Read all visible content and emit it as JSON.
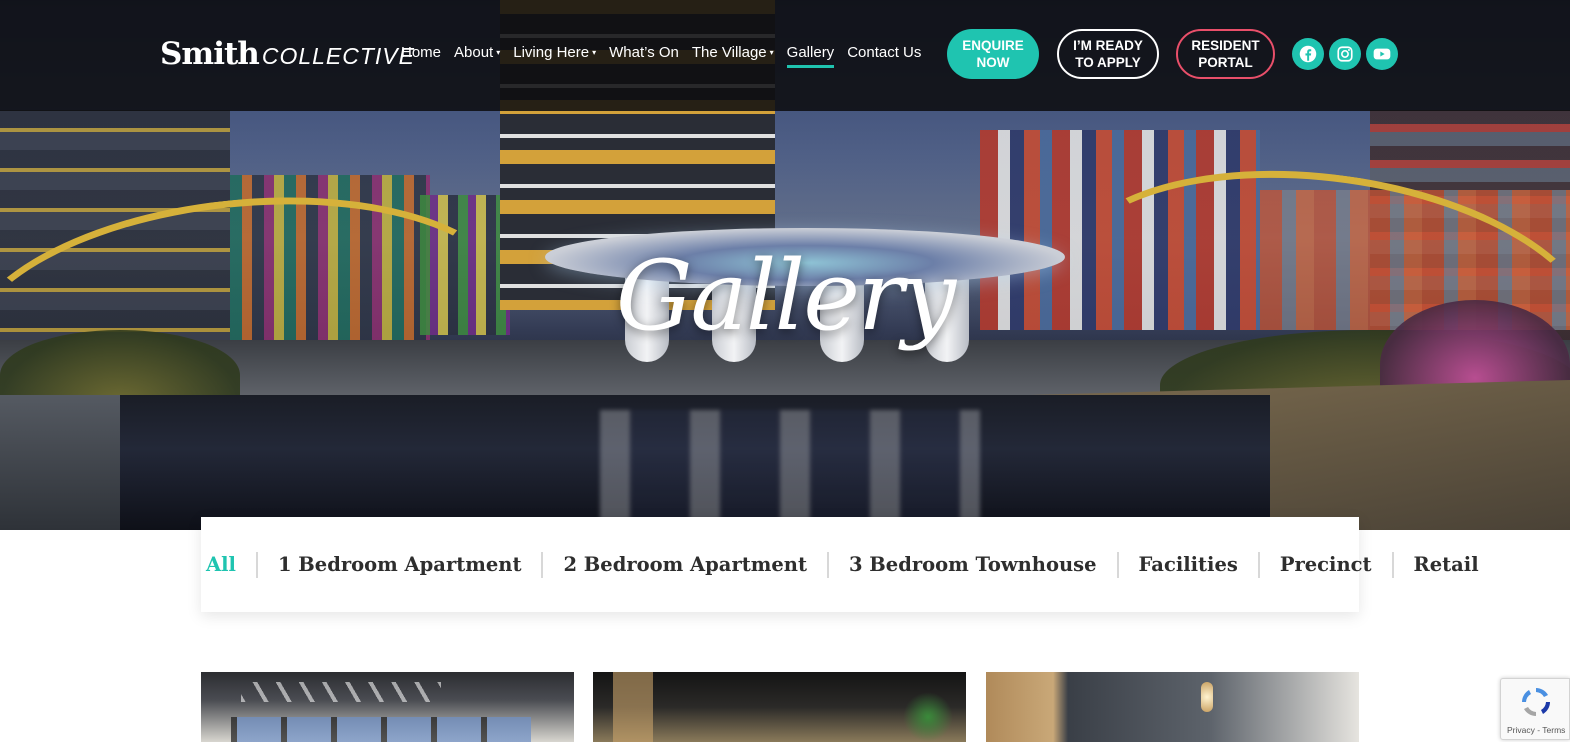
{
  "brand": {
    "logo_main": "Smith",
    "logo_sub": "COLLECTIVE"
  },
  "nav": {
    "items": [
      {
        "label": "Home",
        "dropdown": false,
        "active": false
      },
      {
        "label": "About",
        "dropdown": true,
        "active": false
      },
      {
        "label": "Living Here",
        "dropdown": true,
        "active": false
      },
      {
        "label": "What’s On",
        "dropdown": false,
        "active": false
      },
      {
        "label": "The Village",
        "dropdown": true,
        "active": false
      },
      {
        "label": "Gallery",
        "dropdown": false,
        "active": true
      },
      {
        "label": "Contact Us",
        "dropdown": false,
        "active": false
      }
    ],
    "dropdown_caret": "▾"
  },
  "cta": {
    "enquire_line1": "ENQUIRE",
    "enquire_line2": "NOW",
    "apply_line1": "I’M READY",
    "apply_line2": "TO APPLY",
    "portal_line1": "RESIDENT",
    "portal_line2": "PORTAL"
  },
  "social": [
    {
      "icon": "facebook-icon"
    },
    {
      "icon": "instagram-icon"
    },
    {
      "icon": "youtube-icon"
    }
  ],
  "hero": {
    "title": "Gallery"
  },
  "filters": {
    "items": [
      {
        "label": "All",
        "active": true
      },
      {
        "label": "1 Bedroom Apartment",
        "active": false
      },
      {
        "label": "2 Bedroom Apartment",
        "active": false
      },
      {
        "label": "3 Bedroom Townhouse",
        "active": false
      },
      {
        "label": "Facilities",
        "active": false
      },
      {
        "label": "Precinct",
        "active": false
      },
      {
        "label": "Retail",
        "active": false
      }
    ]
  },
  "recaptcha": {
    "text": "Privacy - Terms"
  },
  "colors": {
    "accent": "#1fc4b0",
    "portal_border": "#e94f6a",
    "header_bg": "#0e0e10",
    "filter_text": "#2e2e2e"
  }
}
